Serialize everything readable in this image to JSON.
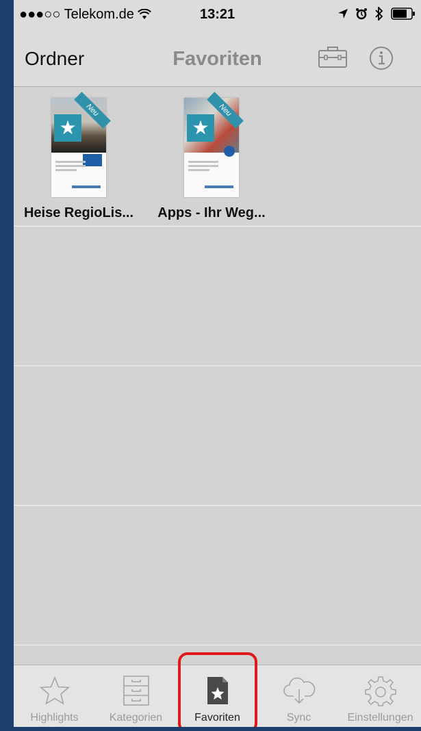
{
  "status_bar": {
    "carrier": "●●●○○ Telekom.de",
    "time": "13:21"
  },
  "nav": {
    "left": "Ordner",
    "title": "Favoriten"
  },
  "books": [
    {
      "title": "Heise RegioLis...",
      "ribbon": "Neu"
    },
    {
      "title": "Apps - Ihr Weg...",
      "ribbon": "Neu"
    }
  ],
  "tabs": [
    {
      "label": "Highlights"
    },
    {
      "label": "Kategorien"
    },
    {
      "label": "Favoriten"
    },
    {
      "label": "Sync"
    },
    {
      "label": "Einstellungen"
    }
  ],
  "colors": {
    "accent_highlight": "#e01a1a",
    "cover_blue": "#2b95ad"
  }
}
